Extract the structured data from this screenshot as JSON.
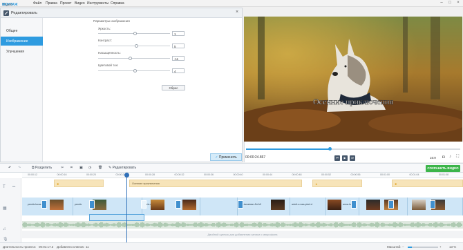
{
  "menubar": {
    "logo_prefix": "Видео",
    "logo_accent": "МОНТАЖ",
    "items": [
      "Файл",
      "Правка",
      "Проект",
      "Видео",
      "Инструменты",
      "Справка"
    ]
  },
  "editor": {
    "title": "Редактировать",
    "sidebar": [
      "Общее",
      "Изображение",
      "Улучшения"
    ],
    "group_title": "Параметры изображения",
    "params": [
      {
        "label": "Яркость:",
        "value": "1",
        "level": 0.52
      },
      {
        "label": "Контраст:",
        "value": "5",
        "level": 0.54
      },
      {
        "label": "Насыщенность:",
        "value": "-11",
        "level": 0.45
      },
      {
        "label": "Цветовой тон:",
        "value": "4",
        "level": 0.52
      }
    ],
    "reset_label": "Сброс",
    "apply_label": "Применить"
  },
  "preview": {
    "overlay_text": "Осенние приключения",
    "timecode": "00:00:24.867",
    "progress": 0.39,
    "aspect": "16:9"
  },
  "toolbar": {
    "split_label": "Разделить",
    "edit_label": "Редактировать",
    "save_label": "СОХРАНИТЬ ВИДЕО"
  },
  "timeline": {
    "ticks": [
      "00:00:12",
      "00:00:16",
      "00:00:20",
      "00:00:24",
      "00:00:28",
      "00:00:32",
      "00:00:36",
      "00:00:40",
      "00:00:44",
      "00:00:48",
      "00:00:52",
      "00:00:56",
      "00:01:00",
      "00:01:04",
      "00:01:08"
    ],
    "title_clip": "Осенние приключения",
    "clip_labels": [
      "pexels-lucas",
      "pexels",
      "pexels-christina",
      "alfa-ismaiwan-Jtx1r0",
      "adult-c-rosa-pixel-d",
      "anna-hunadi"
    ],
    "voice_hint": "Двойной щелчок для добавления записи с микрофона"
  },
  "status": {
    "duration_label": "Длительность проекта:",
    "duration_value": "00:01:17.3",
    "clips_label": "Добавлено клипов:",
    "clips_value": "11",
    "scale_label": "Масштаб:",
    "zoom": "13 %"
  },
  "colors": {
    "accent": "#2e9be0",
    "save_green": "#3cb54a",
    "title_clip": "#f7e4b9",
    "video_track": "#cfe6f7"
  }
}
